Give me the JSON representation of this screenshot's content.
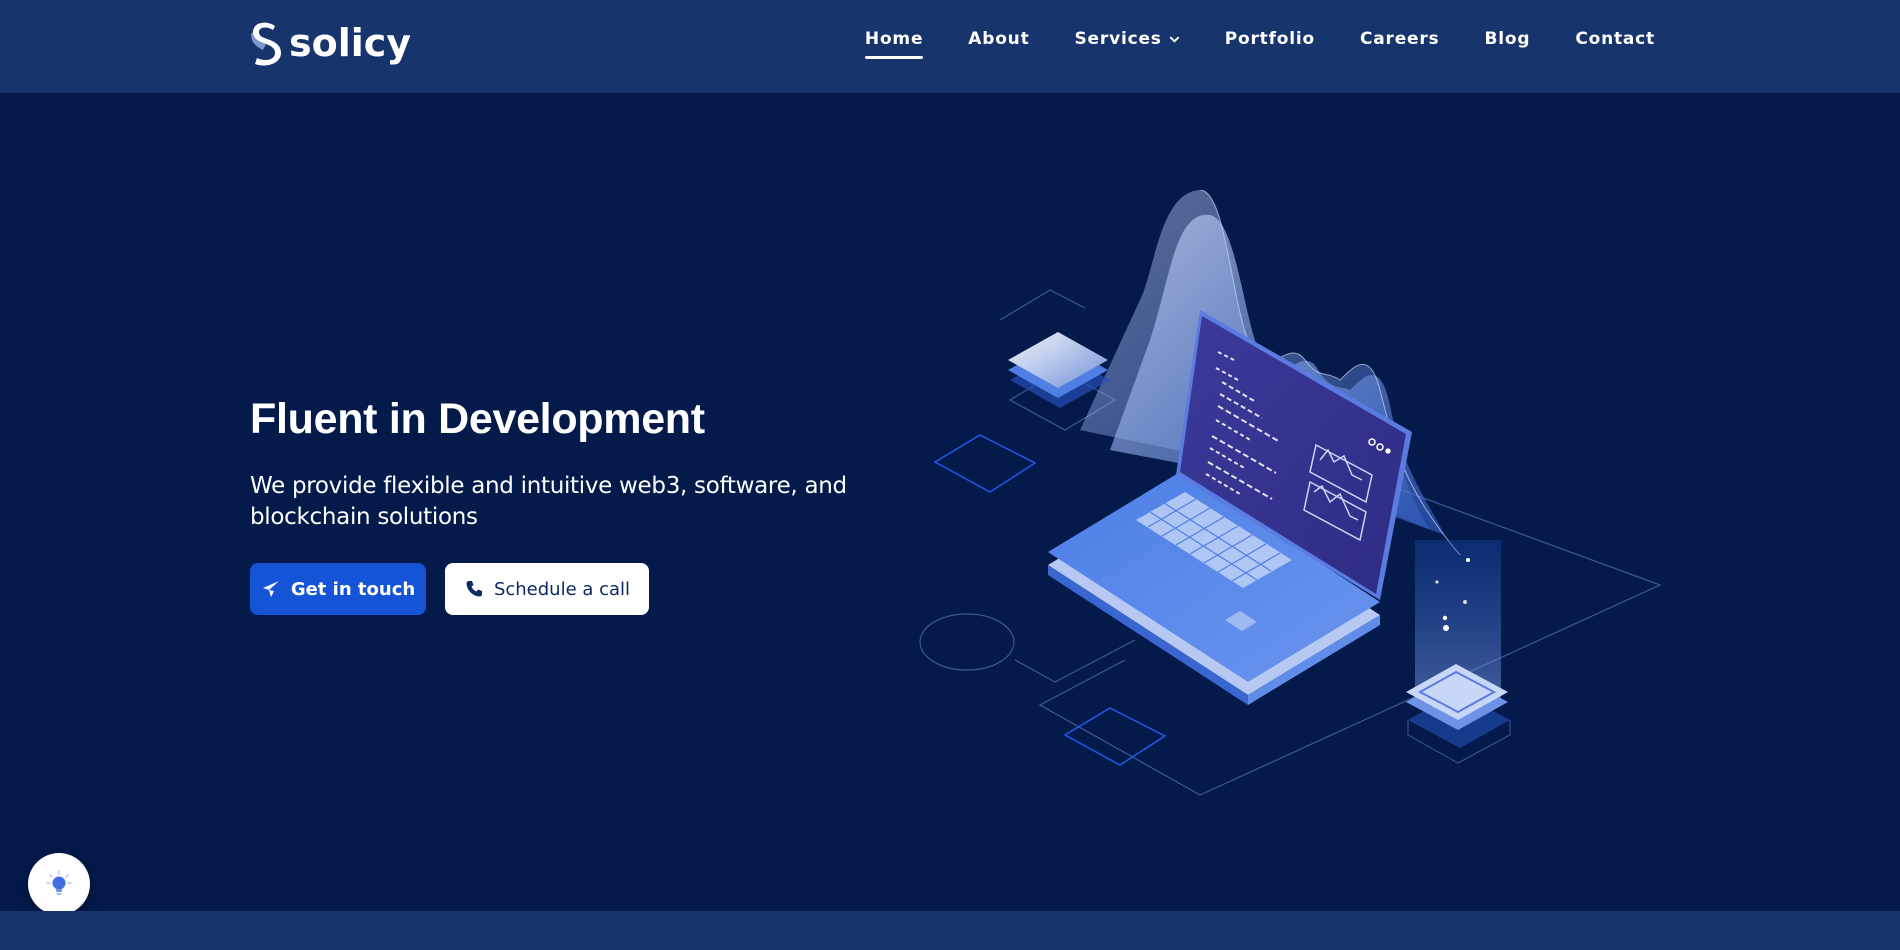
{
  "header": {
    "logo_icon": "solicy-s-logo-icon",
    "logo_text": "solicy",
    "nav": [
      {
        "label": "Home",
        "active": true
      },
      {
        "label": "About"
      },
      {
        "label": "Services",
        "icon": "chevron-down-icon"
      },
      {
        "label": "Portfolio"
      },
      {
        "label": "Careers"
      },
      {
        "label": "Blog"
      },
      {
        "label": "Contact"
      }
    ]
  },
  "hero": {
    "title": "Fluent in Development",
    "subtitle": "We provide flexible and intuitive web3, software, and blockchain solutions",
    "primary_button": {
      "label": "Get in touch",
      "icon": "paper-plane-icon"
    },
    "secondary_button": {
      "label": "Schedule a call",
      "icon": "phone-icon"
    }
  },
  "illustration": {
    "icon": "isometric-laptop-chart-illustration"
  },
  "fab": {
    "icon": "lightbulb-icon"
  },
  "colors": {
    "background": "#031a4b",
    "header": "#17346c",
    "primary": "#1554d6",
    "accent": "#5b86e5",
    "text": "#ffffff"
  }
}
